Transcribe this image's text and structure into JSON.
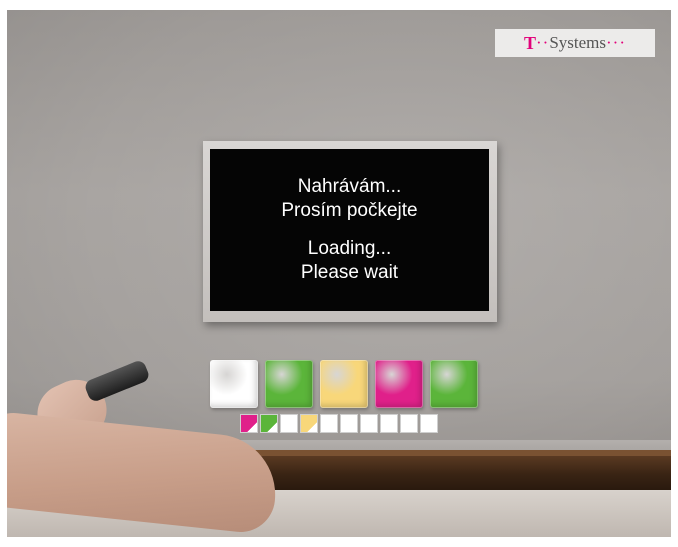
{
  "logo": {
    "t": "T",
    "dots_left": "··",
    "name": "Systems",
    "dots_right": "···"
  },
  "screen": {
    "line1": "Nahrávám...",
    "line2": "Prosím počkejte",
    "line3": "Loading...",
    "line4": "Please wait"
  },
  "colors": {
    "brand_magenta": "#e2007a",
    "tile_white": "#ffffff",
    "tile_green": "#5bb53a",
    "tile_yellow": "#f8d77a",
    "tile_magenta": "#e0208a"
  },
  "tiles": [
    "white",
    "green",
    "yellow",
    "magenta",
    "green"
  ],
  "progress": {
    "cells": 10,
    "cell_colors": [
      "#e0208a",
      "#5bb53a",
      "#ffffff",
      "#f8d77a",
      "#ffffff",
      "#ffffff",
      "#ffffff",
      "#ffffff",
      "#ffffff",
      "#ffffff"
    ]
  }
}
